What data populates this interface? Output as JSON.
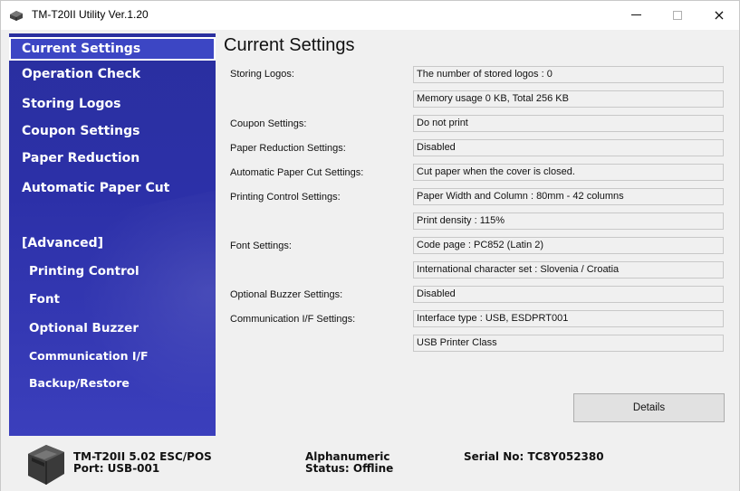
{
  "window": {
    "title": "TM-T20II Utility Ver.1.20",
    "icon": "printer-app-icon",
    "controls": {
      "minimize": "minimize-icon",
      "maximize": "maximize-icon",
      "close": "×"
    }
  },
  "sidebar": {
    "items": [
      {
        "label": "Current Settings",
        "active": true
      },
      {
        "label": "Operation Check"
      },
      {
        "label": "Storing Logos"
      },
      {
        "label": "Coupon Settings"
      },
      {
        "label": "Paper Reduction"
      },
      {
        "label": "Automatic Paper Cut"
      }
    ],
    "advanced_heading": "[Advanced]",
    "advanced_items": [
      {
        "label": "Printing Control"
      },
      {
        "label": "Font"
      },
      {
        "label": "Optional Buzzer"
      },
      {
        "label": "Communication I/F"
      },
      {
        "label": "Backup/Restore"
      }
    ]
  },
  "main": {
    "title": "Current Settings",
    "settings": [
      {
        "label": "Storing Logos:",
        "values": [
          "The number of stored logos : 0",
          "Memory usage 0 KB, Total 256 KB"
        ]
      },
      {
        "label": "Coupon Settings:",
        "values": [
          "Do not print"
        ]
      },
      {
        "label": "Paper Reduction Settings:",
        "values": [
          "Disabled"
        ]
      },
      {
        "label": "Automatic Paper Cut Settings:",
        "values": [
          "Cut paper when the cover is closed."
        ]
      },
      {
        "label": "Printing Control Settings:",
        "values": [
          "Paper Width and Column : 80mm - 42 columns",
          "Print density : 115%"
        ]
      },
      {
        "label": "Font Settings:",
        "values": [
          "Code page : PC852 (Latin 2)",
          "International character set : Slovenia / Croatia"
        ]
      },
      {
        "label": "Optional Buzzer Settings:",
        "values": [
          "Disabled"
        ]
      },
      {
        "label": "Communication I/F Settings:",
        "values": [
          "Interface type : USB, ESDPRT001",
          "USB Printer Class"
        ]
      }
    ],
    "details_label": "Details"
  },
  "footer": {
    "model": "TM-T20II 5.02 ESC/POS",
    "port": "Port: USB-001",
    "mode": "Alphanumeric",
    "status": "Status: Offline",
    "serial": "Serial No: TC8Y052380"
  },
  "colors": {
    "sidebar_bg": "#2c30a8",
    "sidebar_active": "#3c46c4",
    "window_bg": "#f0f0f0"
  }
}
